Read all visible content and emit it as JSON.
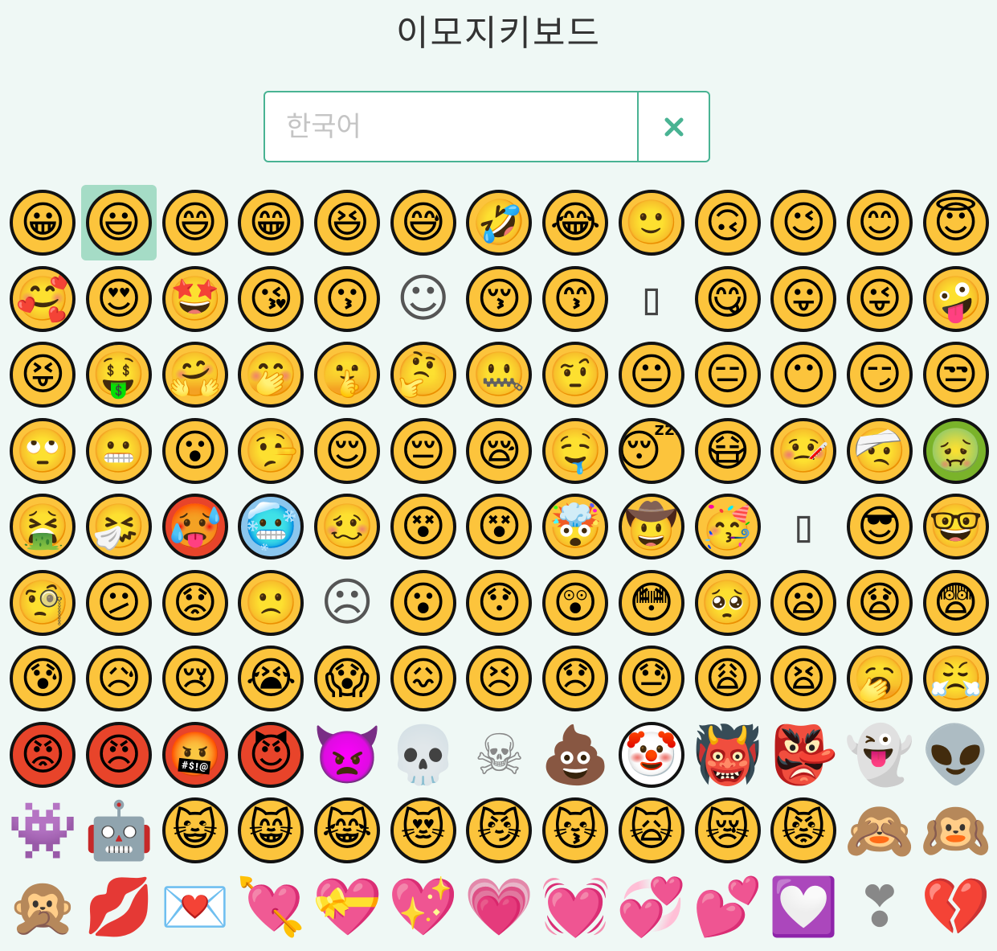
{
  "title": "이모지키보드",
  "search": {
    "placeholder": "한국어",
    "value": "",
    "clear_icon": "close-icon"
  },
  "selected_index": 1,
  "emojis": [
    "😀",
    "😃",
    "😄",
    "😁",
    "😆",
    "😅",
    "🤣",
    "😂",
    "🙂",
    "🙃",
    "😉",
    "😊",
    "😇",
    "🥰",
    "😍",
    "🤩",
    "😘",
    "😗",
    "☺",
    "😚",
    "😙",
    "▯",
    "😋",
    "😛",
    "😜",
    "🤪",
    "😝",
    "🤑",
    "🤗",
    "🤭",
    "🤫",
    "🤔",
    "🤐",
    "🤨",
    "😐",
    "😑",
    "😶",
    "😏",
    "😒",
    "🙄",
    "😬",
    "😮",
    "🤥",
    "😌",
    "😔",
    "😪",
    "🤤",
    "😴",
    "😷",
    "🤒",
    "🤕",
    "🤢",
    "🤮",
    "🤧",
    "🥵",
    "🥶",
    "🥴",
    "😵",
    "😵",
    "🤯",
    "🤠",
    "🥳",
    "▯",
    "😎",
    "🤓",
    "🧐",
    "😕",
    "😟",
    "🙁",
    "☹",
    "😮",
    "😯",
    "😲",
    "😳",
    "🥺",
    "😦",
    "😧",
    "😨",
    "😰",
    "😥",
    "😢",
    "😭",
    "😱",
    "😖",
    "😣",
    "😞",
    "😓",
    "😩",
    "😫",
    "🥱",
    "😤",
    "😡",
    "😠",
    "🤬",
    "😈",
    "👿",
    "💀",
    "☠",
    "💩",
    "🤡",
    "👹",
    "👺",
    "👻",
    "👽",
    "👾",
    "🤖",
    "😺",
    "😸",
    "😹",
    "😻",
    "😼",
    "😽",
    "🙀",
    "😿",
    "😾",
    "🙈",
    "🙉",
    "🙊",
    "💋",
    "💌",
    "💘",
    "💝",
    "💖",
    "💗",
    "💓",
    "💞",
    "💕",
    "💟",
    "❣",
    "💔"
  ]
}
